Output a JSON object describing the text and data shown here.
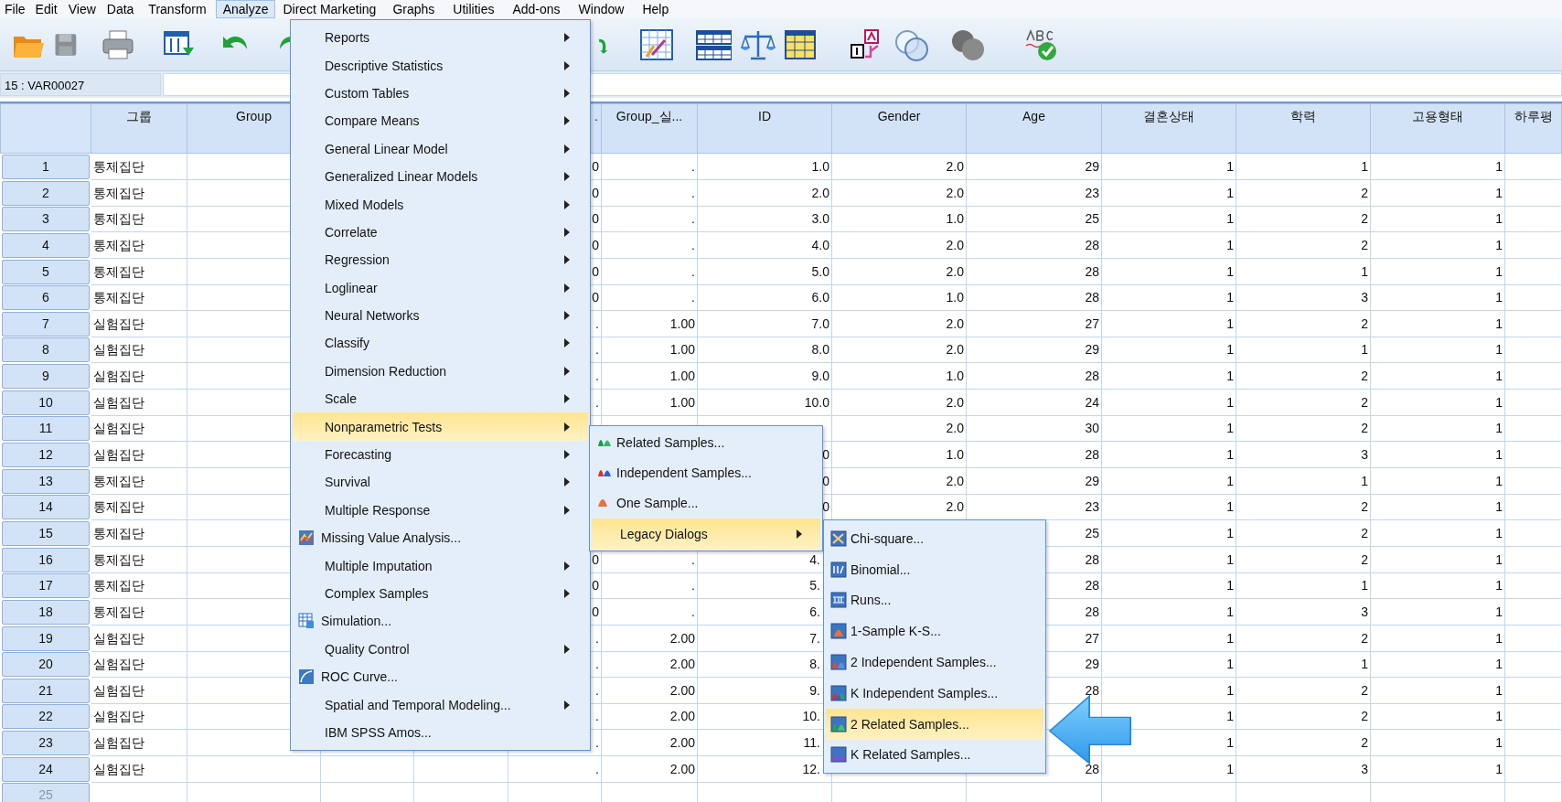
{
  "menu_bar": [
    {
      "label": "File",
      "selected": false
    },
    {
      "label": "Edit",
      "selected": false
    },
    {
      "label": "View",
      "selected": false
    },
    {
      "label": "Data",
      "selected": false
    },
    {
      "label": "Transform",
      "selected": false
    },
    {
      "label": "Analyze",
      "selected": true
    },
    {
      "label": "Direct Marketing",
      "selected": false
    },
    {
      "label": "Graphs",
      "selected": false
    },
    {
      "label": "Utilities",
      "selected": false
    },
    {
      "label": "Add-ons",
      "selected": false
    },
    {
      "label": "Window",
      "selected": false
    },
    {
      "label": "Help",
      "selected": false
    }
  ],
  "cell_reference": "15 : VAR00027",
  "table": {
    "columns": [
      "그룹",
      "Group",
      null,
      null,
      {
        "text": ".",
        "clipped": true
      },
      "Group_실...",
      "ID",
      "Gender",
      "Age",
      "결혼상태",
      "학력",
      "고용형태",
      "하루평"
    ],
    "rows": [
      {
        "number": "1",
        "disabled": false,
        "cells": [
          "통제집단",
          null,
          null,
          null,
          "0",
          ".",
          "1.0",
          "2.0",
          "29",
          "1",
          "1",
          "1"
        ]
      },
      {
        "number": "2",
        "disabled": false,
        "cells": [
          "통제집단",
          null,
          null,
          null,
          "0",
          ".",
          "2.0",
          "2.0",
          "23",
          "1",
          "2",
          "1"
        ]
      },
      {
        "number": "3",
        "disabled": false,
        "cells": [
          "통제집단",
          null,
          null,
          null,
          "0",
          ".",
          "3.0",
          "1.0",
          "25",
          "1",
          "2",
          "1"
        ]
      },
      {
        "number": "4",
        "disabled": false,
        "cells": [
          "통제집단",
          null,
          null,
          null,
          "0",
          ".",
          "4.0",
          "2.0",
          "28",
          "1",
          "2",
          "1"
        ]
      },
      {
        "number": "5",
        "disabled": false,
        "cells": [
          "통제집단",
          null,
          null,
          null,
          "0",
          ".",
          "5.0",
          "2.0",
          "28",
          "1",
          "1",
          "1"
        ]
      },
      {
        "number": "6",
        "disabled": false,
        "cells": [
          "통제집단",
          null,
          null,
          null,
          "0",
          ".",
          "6.0",
          "1.0",
          "28",
          "1",
          "3",
          "1"
        ]
      },
      {
        "number": "7",
        "disabled": false,
        "cells": [
          "실험집단",
          null,
          null,
          null,
          ".",
          "1.00",
          "7.0",
          "2.0",
          "27",
          "1",
          "2",
          "1"
        ]
      },
      {
        "number": "8",
        "disabled": false,
        "cells": [
          "실험집단",
          null,
          null,
          null,
          ".",
          "1.00",
          "8.0",
          "2.0",
          "29",
          "1",
          "1",
          "1"
        ]
      },
      {
        "number": "9",
        "disabled": false,
        "cells": [
          "실험집단",
          null,
          null,
          null,
          ".",
          "1.00",
          "9.0",
          "1.0",
          "28",
          "1",
          "2",
          "1"
        ]
      },
      {
        "number": "10",
        "disabled": false,
        "cells": [
          "실험집단",
          null,
          null,
          null,
          ".",
          "1.00",
          "10.0",
          "2.0",
          "24",
          "1",
          "2",
          "1"
        ]
      },
      {
        "number": "11",
        "disabled": false,
        "cells": [
          "실험집단",
          null,
          null,
          null,
          null,
          null,
          null,
          "2.0",
          "30",
          "1",
          "2",
          "1"
        ]
      },
      {
        "number": "12",
        "disabled": false,
        "cells": [
          "실험집단",
          null,
          null,
          null,
          null,
          null,
          "0",
          "1.0",
          "28",
          "1",
          "3",
          "1"
        ]
      },
      {
        "number": "13",
        "disabled": false,
        "cells": [
          "통제집단",
          null,
          null,
          null,
          null,
          null,
          "0",
          "2.0",
          "29",
          "1",
          "1",
          "1"
        ]
      },
      {
        "number": "14",
        "disabled": false,
        "cells": [
          "통제집단",
          null,
          null,
          null,
          null,
          null,
          "0",
          "2.0",
          "23",
          "1",
          "2",
          "1"
        ]
      },
      {
        "number": "15",
        "disabled": false,
        "cells": [
          "통제집단",
          null,
          null,
          null,
          null,
          null,
          null,
          null,
          "25",
          "1",
          "2",
          "1"
        ]
      },
      {
        "number": "16",
        "disabled": false,
        "cells": [
          "통제집단",
          null,
          null,
          null,
          "0",
          ".",
          {
            "text": "4.",
            "clipped": true
          },
          null,
          "28",
          "1",
          "2",
          "1"
        ]
      },
      {
        "number": "17",
        "disabled": false,
        "cells": [
          "통제집단",
          null,
          null,
          null,
          "0",
          ".",
          {
            "text": "5.",
            "clipped": true
          },
          null,
          "28",
          "1",
          "1",
          "1"
        ]
      },
      {
        "number": "18",
        "disabled": false,
        "cells": [
          "통제집단",
          null,
          null,
          null,
          "0",
          ".",
          {
            "text": "6.",
            "clipped": true
          },
          null,
          "28",
          "1",
          "3",
          "1"
        ]
      },
      {
        "number": "19",
        "disabled": false,
        "cells": [
          "실험집단",
          null,
          null,
          null,
          ".",
          "2.00",
          {
            "text": "7.",
            "clipped": true
          },
          null,
          "27",
          "1",
          "2",
          "1"
        ]
      },
      {
        "number": "20",
        "disabled": false,
        "cells": [
          "실험집단",
          null,
          null,
          null,
          ".",
          "2.00",
          {
            "text": "8.",
            "clipped": true
          },
          null,
          "29",
          "1",
          "1",
          "1"
        ]
      },
      {
        "number": "21",
        "disabled": false,
        "cells": [
          "실험집단",
          null,
          null,
          null,
          ".",
          "2.00",
          {
            "text": "9.",
            "clipped": true
          },
          null,
          "28",
          "1",
          "2",
          "1"
        ]
      },
      {
        "number": "22",
        "disabled": false,
        "cells": [
          "실험집단",
          null,
          null,
          null,
          ".",
          "2.00",
          {
            "text": "10.",
            "clipped": true
          },
          null,
          null,
          "1",
          "2",
          "1"
        ]
      },
      {
        "number": "23",
        "disabled": false,
        "cells": [
          "실험집단",
          null,
          null,
          null,
          ".",
          "2.00",
          {
            "text": "11.",
            "clipped": true
          },
          null,
          null,
          "1",
          "2",
          "1"
        ]
      },
      {
        "number": "24",
        "disabled": false,
        "cells": [
          "실험집단",
          null,
          null,
          null,
          ".",
          "2.00",
          {
            "text": "12.",
            "clipped": true
          },
          null,
          "28",
          "1",
          "3",
          "1"
        ]
      },
      {
        "number": "25",
        "disabled": true
      }
    ]
  },
  "analyze_menu": [
    {
      "label": "Reports",
      "kind": "submenu",
      "selected": false
    },
    {
      "label": "Descriptive Statistics",
      "kind": "submenu",
      "selected": false
    },
    {
      "label": "Custom Tables",
      "kind": "submenu",
      "selected": false
    },
    {
      "label": "Compare Means",
      "kind": "submenu",
      "selected": false
    },
    {
      "label": "General Linear Model",
      "kind": "submenu",
      "selected": false
    },
    {
      "label": "Generalized Linear Models",
      "kind": "submenu",
      "selected": false
    },
    {
      "label": "Mixed Models",
      "kind": "submenu",
      "selected": false
    },
    {
      "label": "Correlate",
      "kind": "submenu",
      "selected": false
    },
    {
      "label": "Regression",
      "kind": "submenu",
      "selected": false
    },
    {
      "label": "Loglinear",
      "kind": "submenu",
      "selected": false
    },
    {
      "label": "Neural Networks",
      "kind": "submenu",
      "selected": false
    },
    {
      "label": "Classify",
      "kind": "submenu",
      "selected": false
    },
    {
      "label": "Dimension Reduction",
      "kind": "submenu",
      "selected": false
    },
    {
      "label": "Scale",
      "kind": "submenu",
      "selected": false
    },
    {
      "label": "Nonparametric Tests",
      "kind": "submenu",
      "selected": true
    },
    {
      "label": "Forecasting",
      "kind": "submenu",
      "selected": false
    },
    {
      "label": "Survival",
      "kind": "submenu",
      "selected": false
    },
    {
      "label": "Multiple Response",
      "kind": "submenu",
      "selected": false
    },
    {
      "label": "Missing Value Analysis...",
      "kind": "command",
      "selected": false
    },
    {
      "label": "Multiple Imputation",
      "kind": "submenu",
      "selected": false
    },
    {
      "label": "Complex Samples",
      "kind": "submenu",
      "selected": false
    },
    {
      "label": "Simulation...",
      "kind": "command",
      "selected": false
    },
    {
      "label": "Quality Control",
      "kind": "submenu",
      "selected": false
    },
    {
      "label": "ROC Curve...",
      "kind": "command",
      "selected": false
    },
    {
      "label": "Spatial and Temporal Modeling...",
      "kind": "submenu",
      "selected": false
    },
    {
      "label": "IBM SPSS Amos...",
      "kind": "command",
      "selected": false
    }
  ],
  "nonparametric_menu": [
    {
      "label": "Related Samples...",
      "kind": "command",
      "selected": false
    },
    {
      "label": "Independent Samples...",
      "kind": "command",
      "selected": false
    },
    {
      "label": "One Sample...",
      "kind": "command",
      "selected": false
    },
    {
      "label": "Legacy Dialogs",
      "kind": "submenu",
      "selected": true
    }
  ],
  "legacy_menu": [
    {
      "label": "Chi-square...",
      "kind": "command",
      "selected": false
    },
    {
      "label": "Binomial...",
      "kind": "command",
      "selected": false
    },
    {
      "label": "Runs...",
      "kind": "command",
      "selected": false
    },
    {
      "label": "1-Sample K-S...",
      "kind": "command",
      "selected": false
    },
    {
      "label": "2 Independent Samples...",
      "kind": "command",
      "selected": false
    },
    {
      "label": "K Independent Samples...",
      "kind": "command",
      "selected": false
    },
    {
      "label": "2 Related Samples...",
      "kind": "command",
      "selected": true
    },
    {
      "label": "K Related Samples...",
      "kind": "command",
      "selected": false
    }
  ]
}
